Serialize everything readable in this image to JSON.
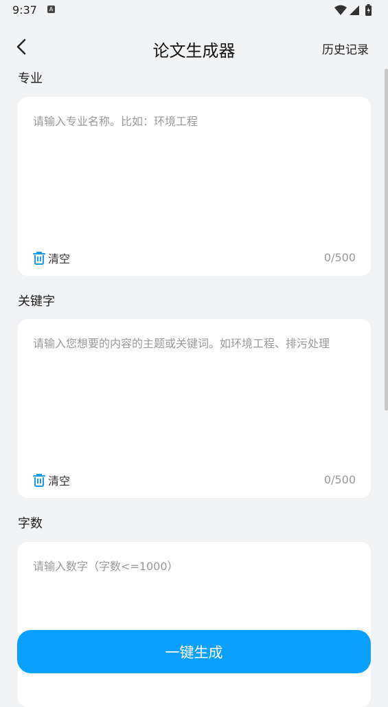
{
  "status_bar": {
    "time": "9:37",
    "notification_icon": "a-icon",
    "system_icons": [
      "wifi-icon",
      "signal-icon",
      "battery-icon"
    ]
  },
  "header": {
    "back_icon": "chevron-left-icon",
    "title": "论文生成器",
    "history_label": "历史记录"
  },
  "major": {
    "label": "专业",
    "value": "",
    "placeholder": "请输入专业名称。比如：环境工程",
    "clear_label": "清空",
    "count": "0/500"
  },
  "keywords": {
    "label": "关键字",
    "value": "",
    "placeholder": "请输入您想要的内容的主题或关键词。如环境工程、排污处理",
    "clear_label": "清空",
    "count": "0/500"
  },
  "word_count": {
    "label": "字数",
    "value": "",
    "placeholder": "请输入数字（字数<=1000）"
  },
  "generate_button": {
    "label": "一键生成"
  },
  "colors": {
    "accent": "#0aa0ff",
    "background": "#f2f3f5",
    "card": "#ffffff",
    "clear_icon": "#1a9be6",
    "placeholder": "#9a9a9a"
  }
}
